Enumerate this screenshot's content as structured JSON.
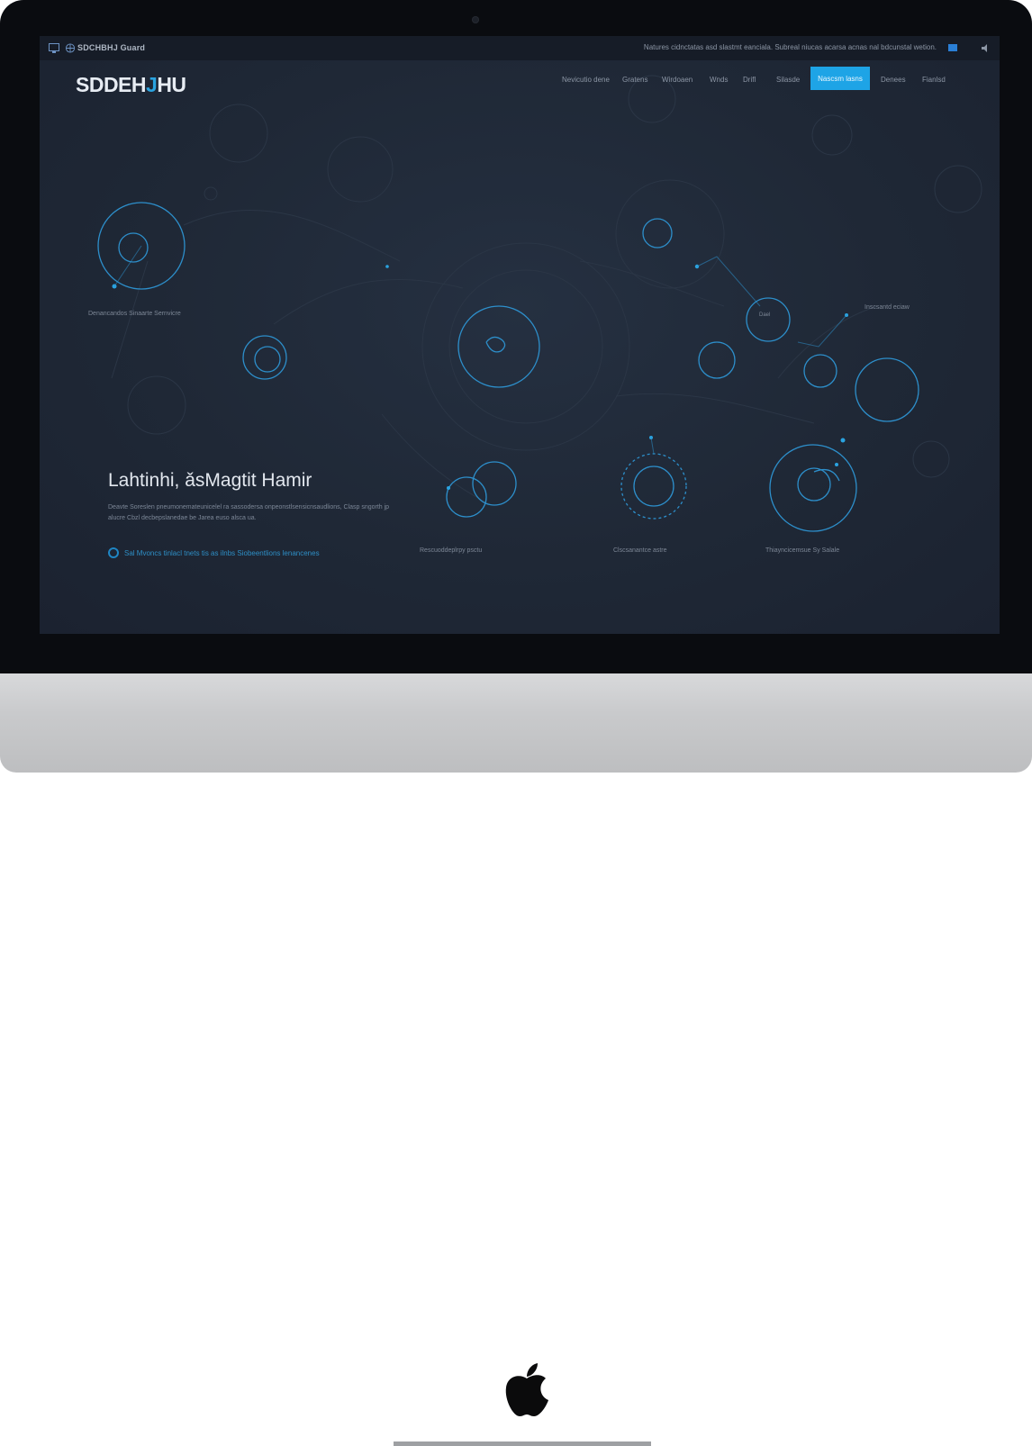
{
  "topbar": {
    "left_text": "SDCHBHJ Guard",
    "right_text": "Natures cidnctatas asd slastmt eanciala. Subreal niucas acarsa acnas nal bdcunstal wetion."
  },
  "brand": {
    "logo_main": "SDDEH",
    "logo_accent": "J",
    "logo_end": "HU"
  },
  "nav": {
    "items": [
      "Nevicutio dene",
      "Gratens",
      "Wirdoaen",
      "Wnds",
      "Drifl",
      "Silasde"
    ],
    "cta": "Nascsm lasns",
    "items_after": [
      "Denees",
      "Fianlsd"
    ]
  },
  "hero": {
    "title": "Lahtinhi, ǎsMagtit Hamir",
    "subtitle": "Deavte Soreslen pneumonemateunicelel ra sassodersa onpeonstlsensicnsaudlions, Clasp sngorth jp alucre Cbzl decbepslanedae be Jarea euso alsca ua.",
    "link": "Sal Mvoncs tinlacl tnets tis as ilnbs Siobeentlions lenancenes"
  },
  "captions": {
    "left_node": "Denancandos Sinaarte Sernvicre",
    "right_node": "Inscsantd eciaw",
    "bottom_1": "Rescuoddeplrpy psctu",
    "bottom_2": "Clscsanantce astre",
    "bottom_3": "Thiayncicemsue Sy Salale",
    "mini_label": "Dael"
  },
  "colors": {
    "accent": "#1ea4e6",
    "screen_bg": "#1f2836",
    "frame": "#0a0c10"
  }
}
